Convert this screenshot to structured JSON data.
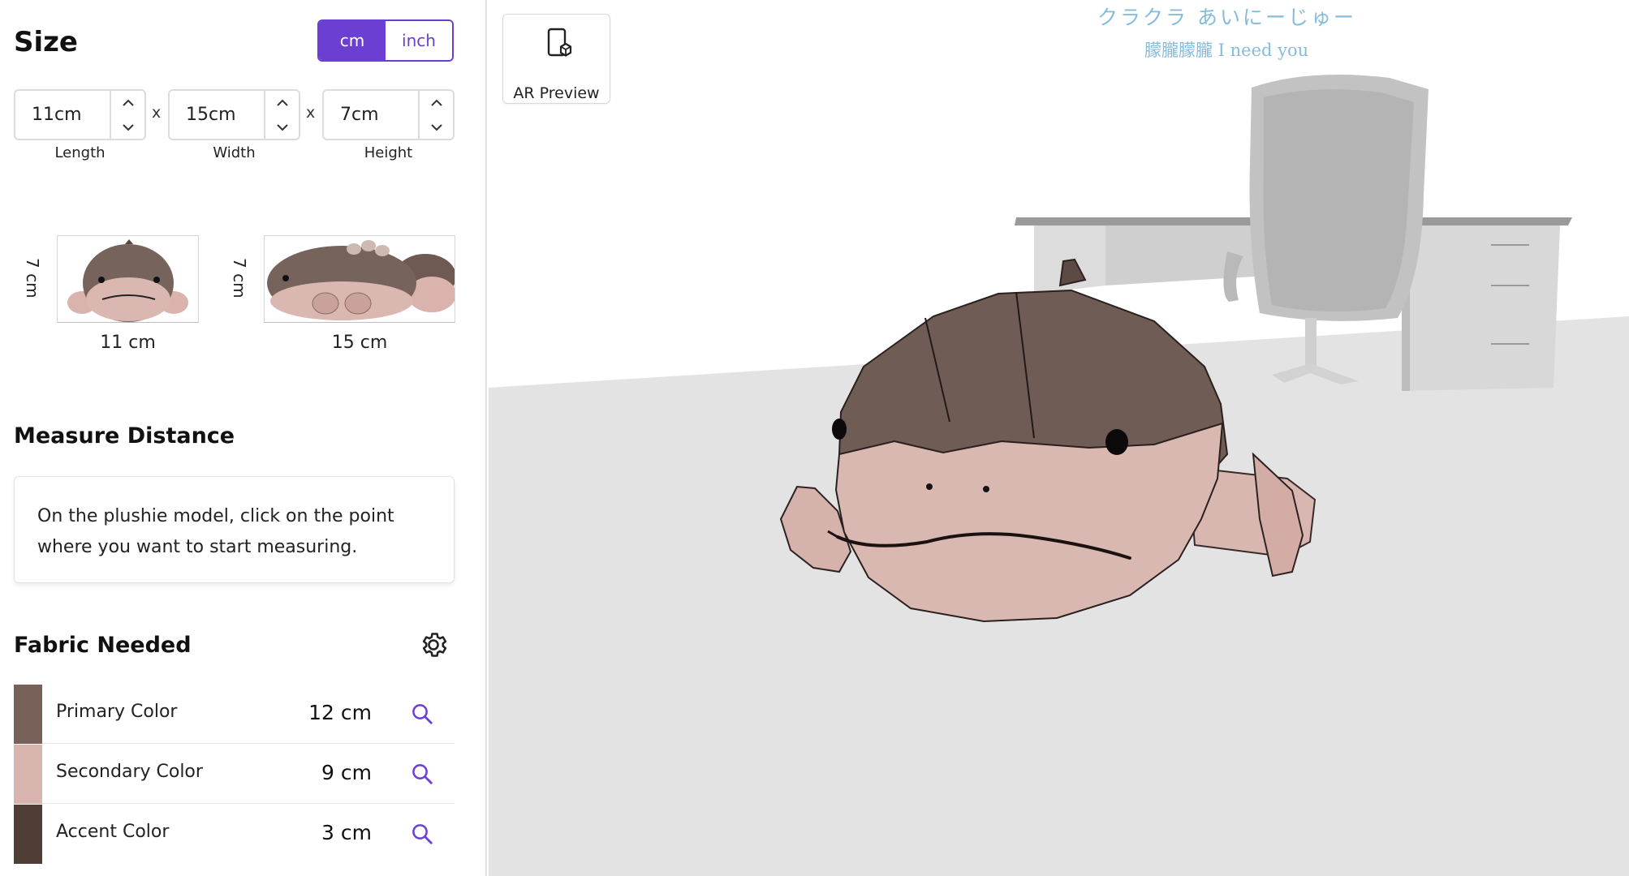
{
  "size": {
    "title": "Size",
    "units": {
      "cm": "cm",
      "inch": "inch",
      "selected": "cm"
    },
    "length": {
      "value": "11cm",
      "label": "Length"
    },
    "width": {
      "value": "15cm",
      "label": "Width"
    },
    "height": {
      "value": "7cm",
      "label": "Height"
    },
    "separator": "x",
    "front_view": {
      "height_label": "7 cm",
      "width_label": "11 cm"
    },
    "side_view": {
      "height_label": "7 cm",
      "width_label": "15 cm"
    }
  },
  "measure": {
    "title": "Measure Distance",
    "instruction_line1": "On the plushie model, click on the point",
    "instruction_line2": "where you want to start measuring."
  },
  "fabric": {
    "title": "Fabric Needed",
    "items": [
      {
        "name": "Primary Color",
        "amount": "12 cm",
        "color": "#786159"
      },
      {
        "name": "Secondary Color",
        "amount": "9 cm",
        "color": "#d8b4ae"
      },
      {
        "name": "Accent Color",
        "amount": "3 cm",
        "color": "#4e3e35"
      }
    ]
  },
  "viewport": {
    "ar_label": "AR Preview",
    "lyrics": [
      "クラクラ あいにーじゅー",
      "朦朧朦朧 I need you"
    ]
  },
  "colors": {
    "accent": "#6b3fd1",
    "floor": "#e2e2e2"
  }
}
